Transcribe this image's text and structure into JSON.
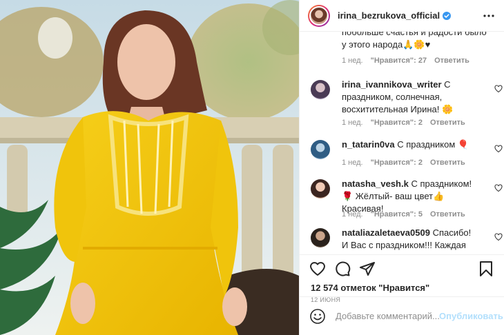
{
  "post": {
    "username": "irina_bezrukova_official",
    "verified": true,
    "more_icon": "more-horizontal-icon"
  },
  "first_comment": {
    "text_partial": "побольше счастья и радости было у этого народа🙏🌼♥",
    "time": "1 нед.",
    "likes": "\"Нравится\": 27",
    "reply": "Ответить"
  },
  "comments": [
    {
      "author": "irina_ivannikova_writer",
      "text": "С праздником, солнечная, восхитительная Ирина! 🌼",
      "time": "1 нед.",
      "likes": "\"Нравится\": 2",
      "reply": "Ответить"
    },
    {
      "author": "n_tatarin0va",
      "text": "С праздником 🎈",
      "time": "1 нед.",
      "likes": "\"Нравится\": 2",
      "reply": "Ответить"
    },
    {
      "author": "natasha_vesh.k",
      "text": "С праздником! 🌹 Жёлтый- ваш цвет👍 Красивая!",
      "time": "1 нед.",
      "likes": "\"Нравится\": 5",
      "reply": "Ответить"
    },
    {
      "author": "nataliazaletaeva0509",
      "text": "Спасибо! И Вас с праздником!!! Каждая"
    }
  ],
  "likes_count": "12 574 отметок \"Нравится\"",
  "date": "12 июня",
  "add_comment": {
    "placeholder": "Добавьте комментарий...",
    "publish": "Опубликовать"
  },
  "colors": {
    "verified": "#3897f0",
    "text": "#262626",
    "secondary": "#8e8e8e",
    "publish_disabled": "#b2dffc",
    "dress": "#f2c200"
  }
}
